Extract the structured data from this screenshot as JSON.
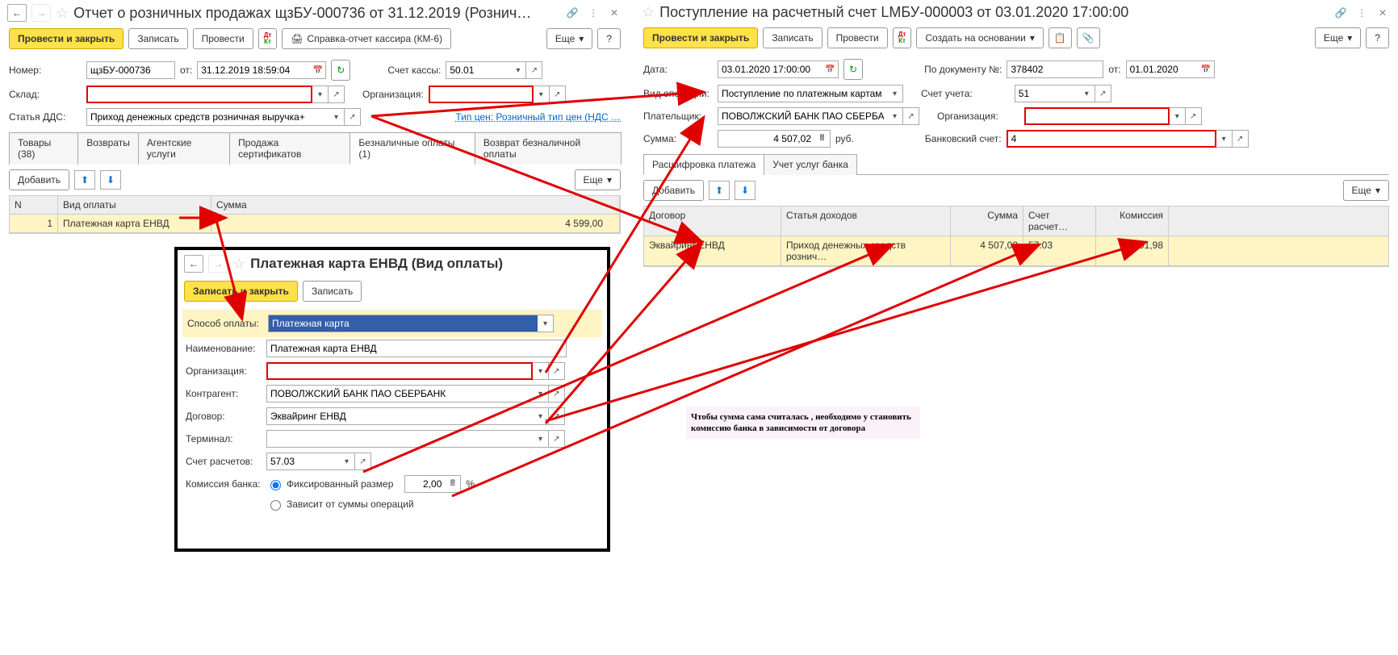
{
  "left": {
    "title": "Отчет о розничных продажах щзБУ-000736 от 31.12.2019 (Рознич…",
    "toolbar": {
      "commit": "Провести и закрыть",
      "write": "Записать",
      "post": "Провести",
      "report": "Справка-отчет кассира (КМ-6)",
      "more": "Еще",
      "help": "?"
    },
    "fields": {
      "number_label": "Номер:",
      "number": "щзБУ-000736",
      "from": "от:",
      "date": "31.12.2019 18:59:04",
      "cash_label": "Счет кассы:",
      "cash": "50.01",
      "store_label": "Склад:",
      "org_label": "Организация:",
      "dds_label": "Статья ДДС:",
      "dds": "Приход денежных средств розничная выручка+",
      "price_type": "Тип цен: Розничный тип цен (НДС …"
    },
    "tabs": [
      "Товары (38)",
      "Возвраты",
      "Агентские услуги",
      "Продажа сертификатов",
      "Безналичные оплаты (1)",
      "Возврат безналичной оплаты"
    ],
    "subbar": {
      "add": "Добавить",
      "more": "Еще"
    },
    "grid": {
      "headers": [
        "N",
        "Вид оплаты",
        "Сумма"
      ],
      "row": {
        "n": "1",
        "type": "Платежная карта ЕНВД",
        "sum": "4 599,00"
      }
    }
  },
  "right": {
    "title": "Поступление на расчетный счет LМБУ-000003 от 03.01.2020 17:00:00",
    "toolbar": {
      "commit": "Провести и закрыть",
      "write": "Записать",
      "post": "Провести",
      "create": "Создать на основании",
      "more": "Еще",
      "help": "?"
    },
    "fields": {
      "date_label": "Дата:",
      "date": "03.01.2020 17:00:00",
      "doc_label": "По документу №:",
      "doc": "378402",
      "from": "от:",
      "docdate": "01.01.2020",
      "op_label": "Вид операции:",
      "op": "Поступление по платежным картам",
      "acc_label": "Счет учета:",
      "acc": "51",
      "payer_label": "Плательщик:",
      "payer": "ПОВОЛЖСКИЙ БАНК ПАО СБЕРБАН",
      "org_label": "Организация:",
      "sum_label": "Сумма:",
      "sum": "4 507,02",
      "ccy": "руб.",
      "bank_label": "Банковский счет:",
      "bankval": "4"
    },
    "tabs": [
      "Расшифровка платежа",
      "Учет услуг банка"
    ],
    "subbar": {
      "add": "Добавить",
      "more": "Еще"
    },
    "grid": {
      "headers": [
        "Договор",
        "Статья доходов",
        "Сумма",
        "Счет расчет…",
        "Комиссия"
      ],
      "row": {
        "contract": "Эквайринг ЕНВД",
        "income": "Приход денежных средств рознич…",
        "sum": "4 507,02",
        "acc": "57.03",
        "fee": "91,98"
      }
    }
  },
  "modal": {
    "title": "Платежная карта ЕНВД (Вид оплаты)",
    "toolbar": {
      "commit": "Записать и закрыть",
      "write": "Записать"
    },
    "f": {
      "method_label": "Способ оплаты:",
      "method": "Платежная карта",
      "name_label": "Наименование:",
      "name": "Платежная карта ЕНВД",
      "org_label": "Организация:",
      "kontr_label": "Контрагент:",
      "kontr": "ПОВОЛЖСКИЙ БАНК ПАО СБЕРБАНК",
      "contract_label": "Договор:",
      "contract": "Эквайринг ЕНВД",
      "term_label": "Терминал:",
      "acc_label": "Счет расчетов:",
      "acc": "57.03",
      "fee_label": "Комиссия банка:",
      "fee_fixed": "Фиксированный размер",
      "fee_val": "2,00",
      "fee_pct": "%",
      "fee_dep": "Зависит от суммы операций"
    }
  },
  "note": "Чтобы сумма сама считалась , необходимо у становить комиссию банка в зависимости от договора"
}
